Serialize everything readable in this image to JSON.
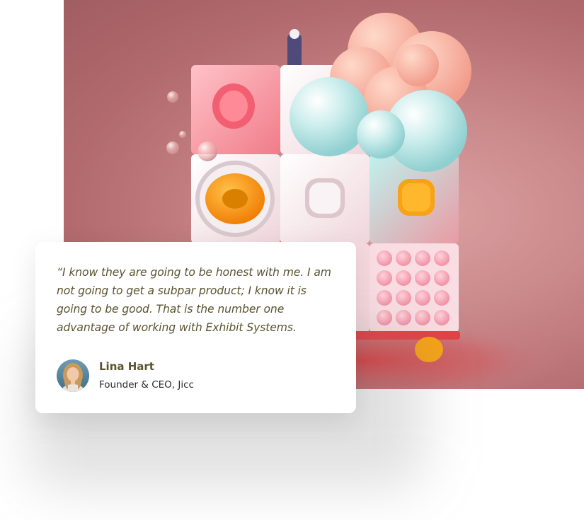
{
  "testimonial": {
    "quote": "“I know they are going to be honest with me. I am not going to get a subpar product; I know it is going to be good. That is the number one advantage of working with Exhibit Systems.",
    "author_name": "Lina Hart",
    "author_role": "Founder & CEO, Jicc"
  },
  "colors": {
    "quote_text": "#5b5330",
    "role_text": "#2a2a2a",
    "hero_background": "#c9878a"
  },
  "icons": {
    "avatar": "person-photo"
  }
}
